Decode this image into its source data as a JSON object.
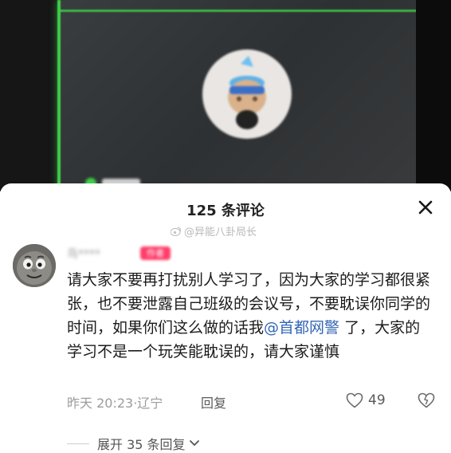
{
  "video": {
    "blurred_label": ""
  },
  "sheet": {
    "title": "125 条评论",
    "close_icon": "close-icon",
    "watermark": "@异能八卦局长"
  },
  "comment": {
    "username": "鸟****",
    "badge": "作者",
    "text_part1": "请大家不要再打扰别人学习了，因为大家的学习都很紧张，也不要泄露自己班级的会议号，不要耽误你同学的时间，如果你们这么做的话我",
    "mention": "@首都网警",
    "text_part2": " 了，大家的学习不是一个玩笑能耽误的，请大家谨慎",
    "time": "昨天 20:23",
    "location": "辽宁",
    "meta_sep": "·",
    "reply_label": "回复",
    "like_count": "49",
    "expand_label": "展开 35 条回复"
  },
  "colors": {
    "accent_green": "#3ecf4a",
    "mention_blue": "#3466b6",
    "badge_pink": "#ff3f6a"
  }
}
